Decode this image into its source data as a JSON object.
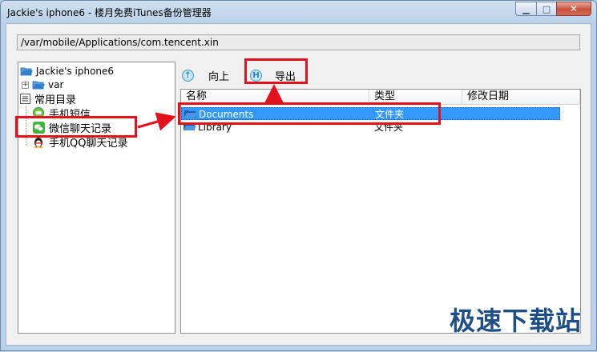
{
  "window": {
    "title": "Jackie's iphone6 - 楼月免费iTunes备份管理器",
    "minimize_glyph": "▁",
    "maximize_glyph": "□",
    "close_glyph": "✕"
  },
  "path_bar": {
    "value": "/var/mobile/Applications/com.tencent.xin"
  },
  "tree": {
    "root_label": "Jackie's iphone6",
    "items": [
      {
        "label": "var",
        "expander": "+"
      },
      {
        "label": "常用目录"
      },
      {
        "label": "手机短信"
      },
      {
        "label": "微信聊天记录"
      },
      {
        "label": "手机QQ聊天记录"
      }
    ]
  },
  "toolbar": {
    "up_label": "向上",
    "export_label": "导出"
  },
  "file_list": {
    "columns": [
      "名称",
      "类型",
      "修改日期"
    ],
    "rows": [
      {
        "name": "Documents",
        "type": "文件夹",
        "date": "",
        "selected": true
      },
      {
        "name": "Library",
        "type": "文件夹",
        "date": "",
        "selected": false
      }
    ]
  },
  "watermark": "极速下载站",
  "colors": {
    "annotation_red": "#e3101e",
    "selection_blue": "#3399ff",
    "folder_blue": "#2f7fd0",
    "wechat_green": "#3fb53a"
  }
}
